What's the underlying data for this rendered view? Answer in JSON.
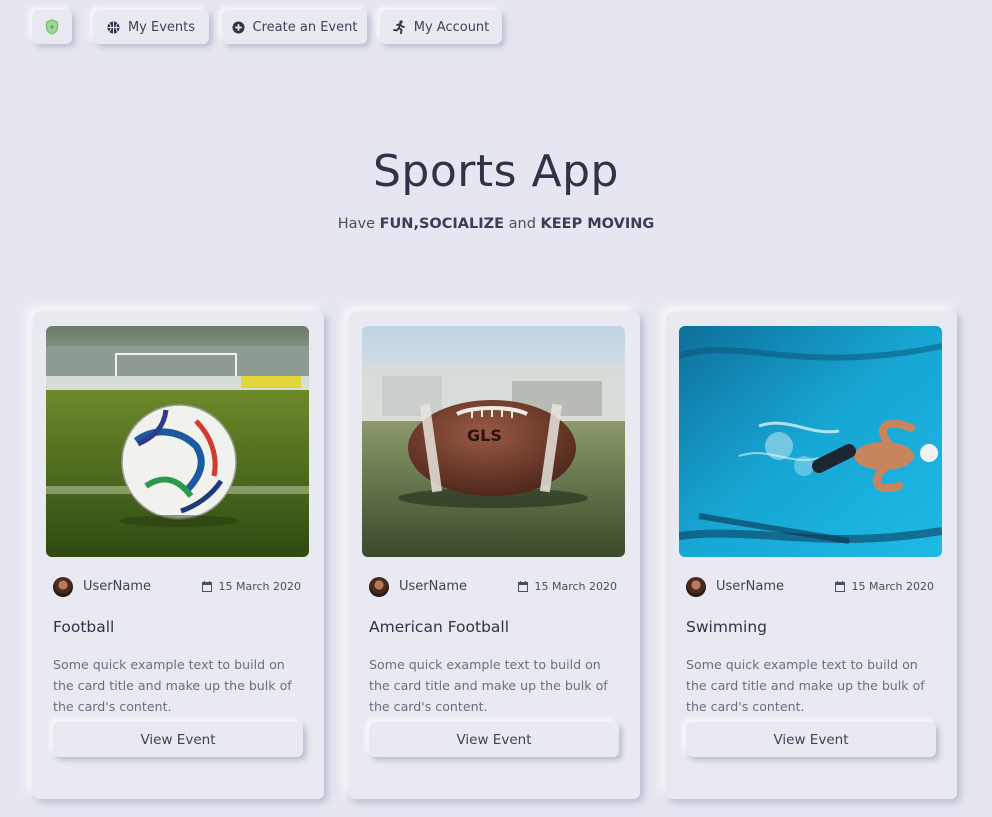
{
  "nav": {
    "my_events": "My Events",
    "create_event": "Create an Event",
    "my_account": "My Account"
  },
  "hero": {
    "title": "Sports App",
    "subtitle_have": "Have ",
    "subtitle_fun": "FUN",
    "subtitle_socialize": ",SOCIALIZE",
    "subtitle_and": " and ",
    "subtitle_keep": "KEEP MOVING"
  },
  "cards": [
    {
      "username": "UserName",
      "date": "15 March 2020",
      "title": "Football",
      "text": "Some quick example text to build on the card title and make up the bulk of the card's content.",
      "button": "View Event"
    },
    {
      "username": "UserName",
      "date": "15 March 2020",
      "title": "American Football",
      "text": "Some quick example text to build on the card title and make up the bulk of the card's content.",
      "button": "View Event"
    },
    {
      "username": "UserName",
      "date": "15 March 2020",
      "title": "Swimming",
      "text": "Some quick example text to build on the card title and make up the bulk of the card's content.",
      "button": "View Event"
    }
  ],
  "icons": {
    "logo": "shield-icon",
    "my_events": "basketball-icon",
    "create_event": "plus-circle-icon",
    "my_account": "running-icon",
    "date": "calendar-icon"
  },
  "colors": {
    "background": "#e5e6ef",
    "logo_green": "#7cc576",
    "text_dark": "#2f3347"
  }
}
